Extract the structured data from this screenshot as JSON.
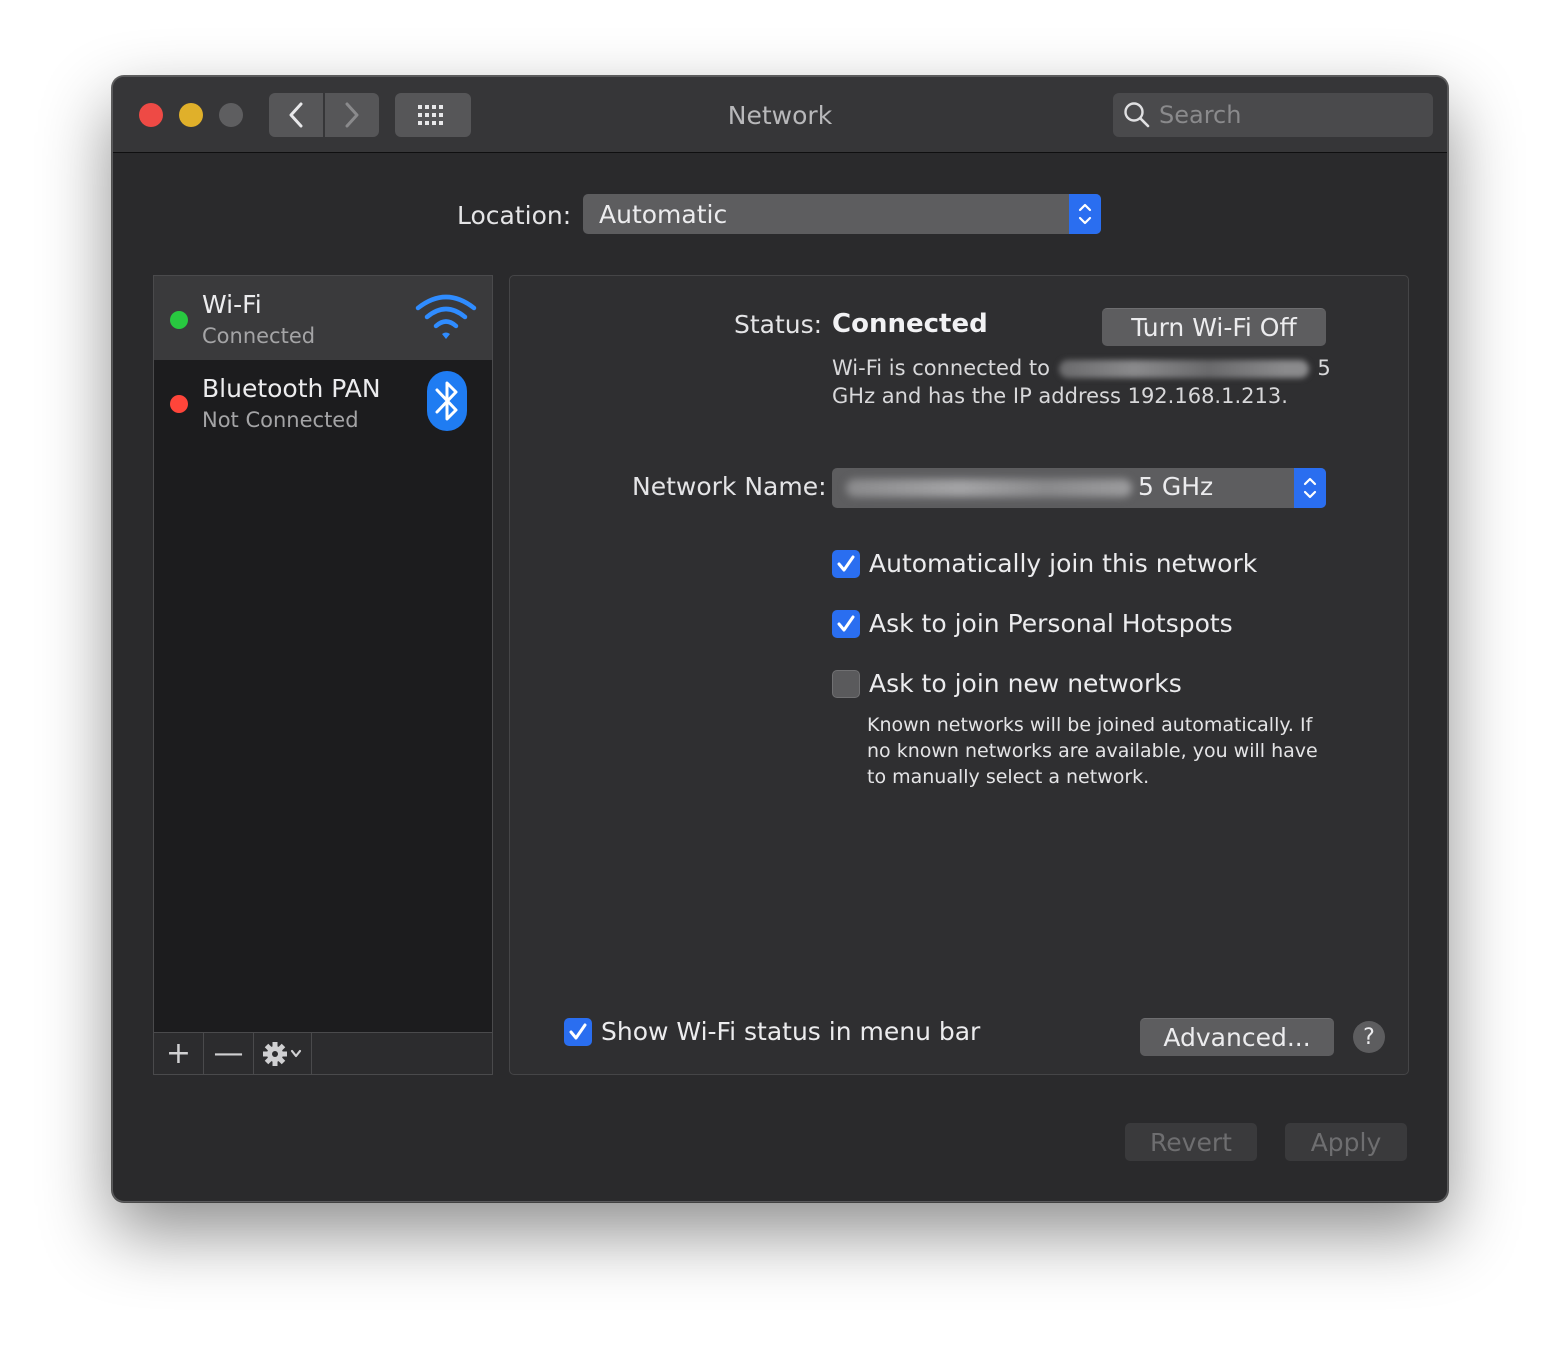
{
  "window": {
    "title": "Network"
  },
  "toolbar": {
    "back_icon": "chevron-left-icon",
    "forward_icon": "chevron-right-icon",
    "show_all_icon": "grid-icon",
    "search_placeholder": "Search"
  },
  "location": {
    "label": "Location:",
    "value": "Automatic"
  },
  "sidebar": {
    "services": [
      {
        "name": "Wi-Fi",
        "status": "Connected",
        "status_color": "#28c840",
        "icon": "wifi-icon",
        "selected": true
      },
      {
        "name": "Bluetooth PAN",
        "status": "Not Connected",
        "status_color": "#ff453a",
        "icon": "bluetooth-icon",
        "selected": false
      }
    ],
    "tools": {
      "add_label": "+",
      "remove_label": "—",
      "action_icon": "gear-icon"
    }
  },
  "detail": {
    "status_label": "Status:",
    "status_value": "Connected",
    "turn_off_label": "Turn Wi-Fi Off",
    "status_desc_pre": "Wi-Fi is connected to",
    "status_desc_post": "5 GHz and has the IP address 192.168.1.213.",
    "network_name_label": "Network Name:",
    "network_name_suffix": "5 GHz",
    "checkboxes": {
      "auto_join": {
        "label": "Automatically join this network",
        "checked": true
      },
      "hotspots": {
        "label": "Ask to join Personal Hotspots",
        "checked": true
      },
      "new_networks": {
        "label": "Ask to join new networks",
        "checked": false
      }
    },
    "help_text": "Known networks will be joined automatically. If no known networks are available, you will have to manually select a network.",
    "show_menubar": {
      "label": "Show Wi-Fi status in menu bar",
      "checked": true
    },
    "advanced_label": "Advanced...",
    "help_label": "?"
  },
  "footer": {
    "revert_label": "Revert",
    "apply_label": "Apply"
  },
  "colors": {
    "accent": "#2a6ef0",
    "window_bg": "#2a2a2c",
    "close": "#ee4a45",
    "minimize": "#e0b02a"
  }
}
